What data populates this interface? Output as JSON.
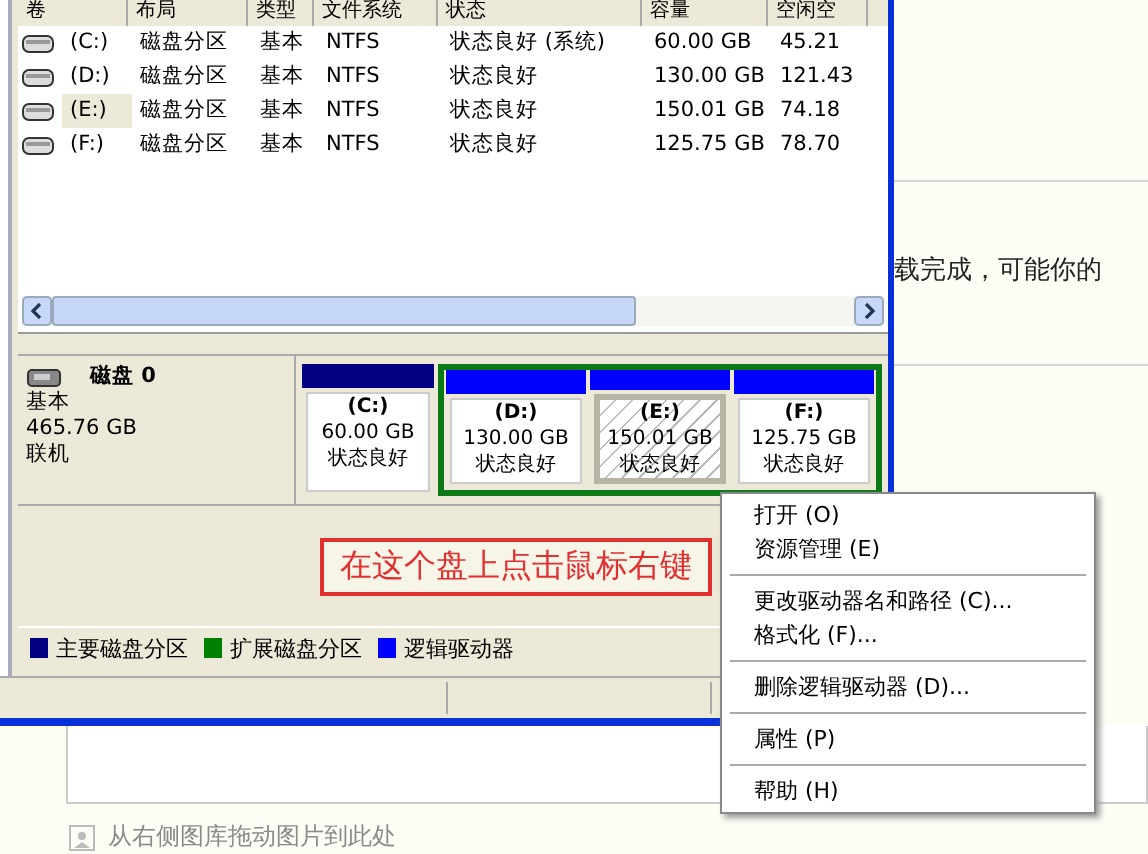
{
  "table": {
    "columns": [
      "卷",
      "布局",
      "类型",
      "文件系统",
      "状态",
      "容量",
      "空闲空"
    ],
    "rows": [
      {
        "cells": [
          "(C:)",
          "磁盘分区",
          "基本",
          "NTFS",
          "状态良好 (系统)",
          "60.00 GB",
          "45.21"
        ],
        "selected": false
      },
      {
        "cells": [
          "(D:)",
          "磁盘分区",
          "基本",
          "NTFS",
          "状态良好",
          "130.00 GB",
          "121.43"
        ],
        "selected": false
      },
      {
        "cells": [
          "(E:)",
          "磁盘分区",
          "基本",
          "NTFS",
          "状态良好",
          "150.01 GB",
          "74.18"
        ],
        "selected": true
      },
      {
        "cells": [
          "(F:)",
          "磁盘分区",
          "基本",
          "NTFS",
          "状态良好",
          "125.75 GB",
          "78.70"
        ],
        "selected": false
      }
    ]
  },
  "disk": {
    "name": "磁盘 0",
    "type": "基本",
    "size": "465.76 GB",
    "status": "联机",
    "partitions": [
      {
        "kind": "primary",
        "label": "(C:)",
        "size": "60.00 GB",
        "status": "状态良好",
        "selected": false
      },
      {
        "kind": "logical",
        "label": "(D:)",
        "size": "130.00 GB",
        "status": "状态良好",
        "selected": false
      },
      {
        "kind": "logical",
        "label": "(E:)",
        "size": "150.01 GB",
        "status": "状态良好",
        "selected": true
      },
      {
        "kind": "logical",
        "label": "(F:)",
        "size": "125.75 GB",
        "status": "状态良好",
        "selected": false
      }
    ]
  },
  "annotation": "在这个盘上点击鼠标右键",
  "legend": [
    {
      "label": "主要磁盘分区",
      "color": "#000080"
    },
    {
      "label": "扩展磁盘分区",
      "color": "#008000"
    },
    {
      "label": "逻辑驱动器",
      "color": "#0000ff"
    }
  ],
  "page_text": "载完成，可能你的",
  "drop_hint": "从右侧图库拖动图片到此处",
  "menu": [
    {
      "kind": "item",
      "label": "打开",
      "key": "(O)"
    },
    {
      "kind": "item",
      "label": "资源管理",
      "key": "(E)"
    },
    {
      "kind": "separator"
    },
    {
      "kind": "item",
      "label": "更改驱动器名和路径",
      "key": "(C)..."
    },
    {
      "kind": "item",
      "label": "格式化",
      "key": "(F)..."
    },
    {
      "kind": "separator"
    },
    {
      "kind": "item",
      "label": "删除逻辑驱动器",
      "key": "(D)..."
    },
    {
      "kind": "separator"
    },
    {
      "kind": "item",
      "label": "属性",
      "key": "(P)"
    },
    {
      "kind": "separator"
    },
    {
      "kind": "item",
      "label": "帮助",
      "key": "(H)"
    }
  ]
}
